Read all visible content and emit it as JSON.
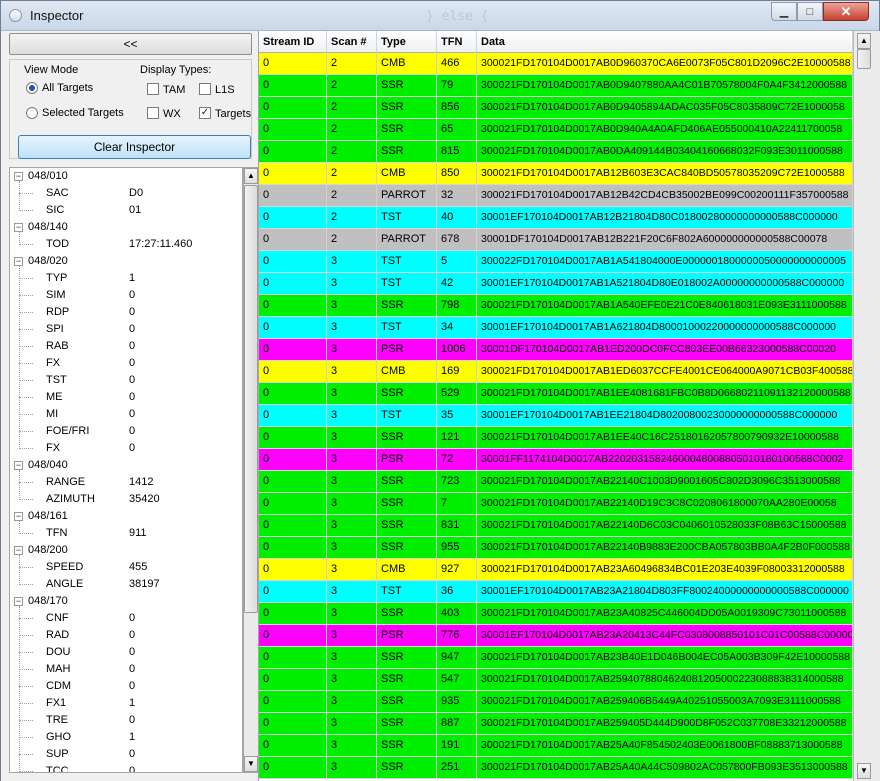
{
  "window": {
    "title": "Inspector",
    "ghost_text": "} else {"
  },
  "panel": {
    "collapse_label": "<<",
    "view_mode_label": "View Mode",
    "view_all": "All Targets",
    "view_selected": "Selected Targets",
    "display_types_label": "Display Types:",
    "types": [
      {
        "label": "TAM",
        "checked": false
      },
      {
        "label": "L1S",
        "checked": false
      },
      {
        "label": "WX",
        "checked": false
      },
      {
        "label": "Targets",
        "checked": true
      }
    ],
    "clear_label": "Clear Inspector"
  },
  "tree": [
    {
      "group": "048/010",
      "items": [
        [
          "SAC",
          "D0"
        ],
        [
          "SIC",
          "01"
        ]
      ]
    },
    {
      "group": "048/140",
      "items": [
        [
          "TOD",
          "17:27:11.460"
        ]
      ]
    },
    {
      "group": "048/020",
      "items": [
        [
          "TYP",
          "1"
        ],
        [
          "SIM",
          "0"
        ],
        [
          "RDP",
          "0"
        ],
        [
          "SPI",
          "0"
        ],
        [
          "RAB",
          "0"
        ],
        [
          "FX",
          "0"
        ],
        [
          "TST",
          "0"
        ],
        [
          "ME",
          "0"
        ],
        [
          "MI",
          "0"
        ],
        [
          "FOE/FRI",
          "0"
        ],
        [
          "FX",
          "0"
        ]
      ]
    },
    {
      "group": "048/040",
      "items": [
        [
          "RANGE",
          "1412"
        ],
        [
          "AZIMUTH",
          "35420"
        ]
      ]
    },
    {
      "group": "048/161",
      "items": [
        [
          "TFN",
          "911"
        ]
      ]
    },
    {
      "group": "048/200",
      "items": [
        [
          "SPEED",
          "455"
        ],
        [
          "ANGLE",
          "38197"
        ]
      ]
    },
    {
      "group": "048/170",
      "items": [
        [
          "CNF",
          "0"
        ],
        [
          "RAD",
          "0"
        ],
        [
          "DOU",
          "0"
        ],
        [
          "MAH",
          "0"
        ],
        [
          "CDM",
          "0"
        ],
        [
          "FX1",
          "1"
        ],
        [
          "TRE",
          "0"
        ],
        [
          "GHO",
          "1"
        ],
        [
          "SUP",
          "0"
        ],
        [
          "TCC",
          "0"
        ]
      ]
    }
  ],
  "grid": {
    "columns": [
      "Stream ID",
      "Scan #",
      "Type",
      "TFN",
      "Data"
    ],
    "type_colors": {
      "CMB": "#ffff00",
      "SSR": "#00ee00",
      "PARROT": "#c0c0c0",
      "TST": "#00ffff",
      "PSR": "#ff00ff"
    },
    "rows": [
      [
        "0",
        "2",
        "CMB",
        "466",
        "300021FD170104D0017AB0D960370CA6E0073F05C801D2096C2E10000588"
      ],
      [
        "0",
        "2",
        "SSR",
        "79",
        "300021FD170104D0017AB0D9407880AA4C01B70578004F0A4F3412000588"
      ],
      [
        "0",
        "2",
        "SSR",
        "856",
        "300021FD170104D0017AB0D9405894ADAC035F05C8035809C72E1000058"
      ],
      [
        "0",
        "2",
        "SSR",
        "65",
        "300021FD170104D0017AB0D940A4A0AFD406AE055000410A22411700058"
      ],
      [
        "0",
        "2",
        "SSR",
        "815",
        "300021FD170104D0017AB0DA409144B03404160668032F093E3011000588"
      ],
      [
        "0",
        "2",
        "CMB",
        "850",
        "300021FD170104D0017AB12B603E3CAC840BD50578035209C72E1000588"
      ],
      [
        "0",
        "2",
        "PARROT",
        "32",
        "300021FD170104D0017AB12B42CD4CB35002BE099C00200111F357000588"
      ],
      [
        "0",
        "2",
        "TST",
        "40",
        "30001EF170104D0017AB12B21804D80C01800280000000000588C000000"
      ],
      [
        "0",
        "2",
        "PARROT",
        "678",
        "30001DF170104D0017AB12B221F20C6F802A600000000000588C00078"
      ],
      [
        "0",
        "3",
        "TST",
        "5",
        "300022FD170104D0017AB1A541804000E0000001800000050000000000005"
      ],
      [
        "0",
        "3",
        "TST",
        "42",
        "30001EF170104D0017AB1A521804D80E018002A00000000000588C000000"
      ],
      [
        "0",
        "3",
        "SSR",
        "798",
        "300021FD170104D0017AB1A540EFE0E21C0E840618031E093E3111000588"
      ],
      [
        "0",
        "3",
        "TST",
        "34",
        "30001EF170104D0017AB1A621804D80001000220000000000588C000000"
      ],
      [
        "0",
        "3",
        "PSR",
        "1006",
        "30001DF170104D0017AB1ED200DC0FCC803EE00B66323000588C00020"
      ],
      [
        "0",
        "3",
        "CMB",
        "169",
        "300021FD170104D0017AB1ED6037CCFE4001CE064000A9071CB03F400588"
      ],
      [
        "0",
        "3",
        "SSR",
        "529",
        "300021FD170104D0017AB1EE4081681FBC0B8D06680211091132120000588"
      ],
      [
        "0",
        "3",
        "TST",
        "35",
        "30001EF170104D0017AB1EE21804D80200800230000000000588C000000"
      ],
      [
        "0",
        "3",
        "SSR",
        "121",
        "300021FD170104D0017AB1EE40C16C25180162057800790932E10000588"
      ],
      [
        "0",
        "3",
        "PSR",
        "72",
        "30001FF1174104D0017AB22020315824600048008805010180100588C0002"
      ],
      [
        "0",
        "3",
        "SSR",
        "723",
        "300021FD170104D0017AB22140C1003D9001605C802D3096C3513000588"
      ],
      [
        "0",
        "3",
        "SSR",
        "7",
        "300021FD170104D0017AB22140D19C3C8C0208061800070AA280E00058"
      ],
      [
        "0",
        "3",
        "SSR",
        "831",
        "300021FD170104D0017AB22140D6C03C0406010528033F08B63C15000588"
      ],
      [
        "0",
        "3",
        "SSR",
        "955",
        "300021FD170104D0017AB22140B9883E200CBA057803BB0A4F2B0F000588"
      ],
      [
        "0",
        "3",
        "CMB",
        "927",
        "300021FD170104D0017AB23A60496834BC01E203E4039F08003312000588"
      ],
      [
        "0",
        "3",
        "TST",
        "36",
        "30001EF170104D0017AB23A21804D803FF80024000000000000588C000000"
      ],
      [
        "0",
        "3",
        "SSR",
        "403",
        "300021FD170104D0017AB23A40825C446004DD05A0019309C73011000588"
      ],
      [
        "0",
        "3",
        "PSR",
        "776",
        "30001EF170104D0017AB23A20413C44FC0308008850101C01C00588C00000"
      ],
      [
        "0",
        "3",
        "SSR",
        "947",
        "300021FD170104D0017AB23B40E1D046B004EC05A003B309F42E10000588"
      ],
      [
        "0",
        "3",
        "SSR",
        "547",
        "300021FD170104D0017AB2594078804624081205000223088838314000588"
      ],
      [
        "0",
        "3",
        "SSR",
        "935",
        "300021FD170104D0017AB259406B5449A40251055003A7093E3111000588"
      ],
      [
        "0",
        "3",
        "SSR",
        "887",
        "300021FD170104D0017AB259405D444D900D8F052C037708E33212000588"
      ],
      [
        "0",
        "3",
        "SSR",
        "191",
        "300021FD170104D0017AB25A40F854502403E0061800BF08883713000588"
      ],
      [
        "0",
        "3",
        "SSR",
        "251",
        "300021FD170104D0017AB25A40A44C509802AC057800FB093E3513000588"
      ]
    ]
  }
}
